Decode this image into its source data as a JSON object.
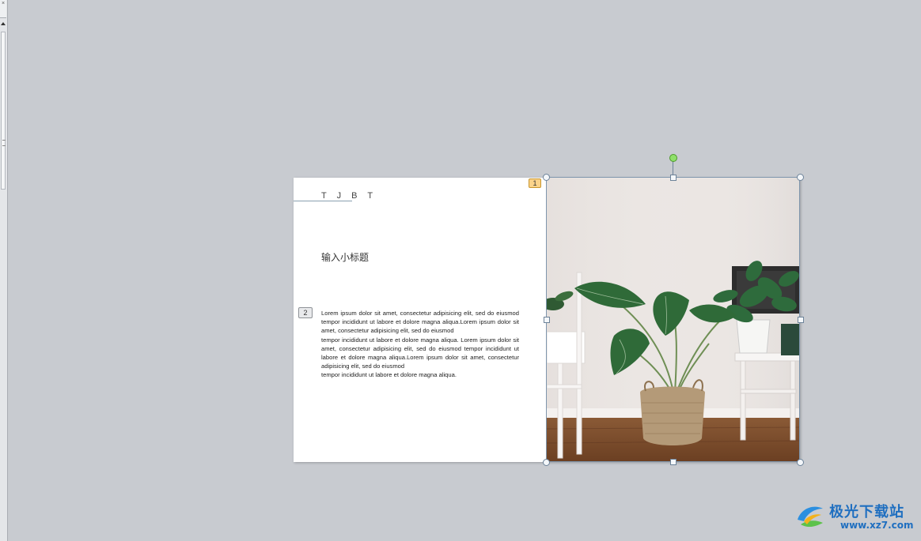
{
  "slide": {
    "title": "T J B T",
    "subtitle": "输入小标题",
    "body_paragraph_1": "Lorem ipsum dolor sit amet, consectetur adipisicing elit, sed do eiusmod tempor incididunt ut labore et dolore magna aliqua.Lorem ipsum dolor sit amet, consectetur adipisicing elit, sed do eiusmod",
    "body_paragraph_2": "tempor incididunt ut labore et dolore magna aliqua. Lorem ipsum dolor sit amet, consectetur adipisicing elit, sed do eiusmod tempor incididunt ut labore et dolore magna aliqua.Lorem ipsum dolor sit amet, consectetur adipisicing elit, sed do eiusmod",
    "body_paragraph_3": "tempor incididunt ut labore et dolore magna aliqua.",
    "animation_tags": [
      "1",
      "2"
    ]
  },
  "watermark": {
    "name": "极光下载站",
    "url": "www.xz7.com"
  },
  "colors": {
    "workspace": "#c8cbd0",
    "slide_bg": "#ffffff",
    "tag_1": "#fbd38a",
    "rotate_handle": "#8fe06a",
    "watermark": "#1f6fc0"
  }
}
